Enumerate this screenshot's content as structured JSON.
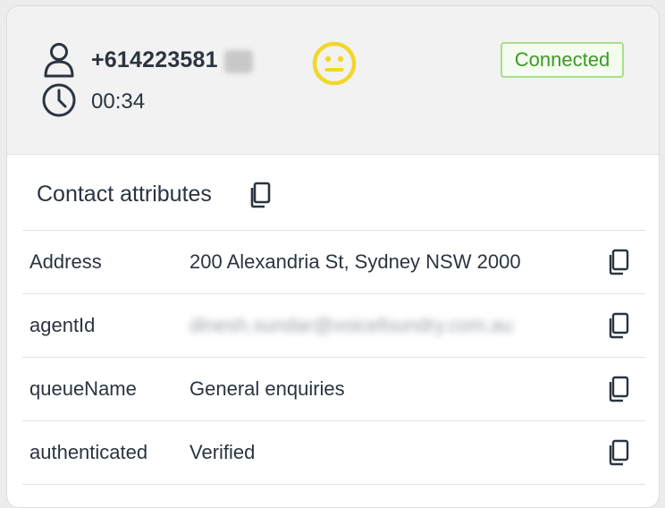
{
  "header": {
    "phone": "+614223581",
    "timer": "00:34",
    "status": "Connected",
    "sentiment_icon": "neutral-face-icon",
    "colors": {
      "status_text": "#3d9a25",
      "status_border": "#a7df8a",
      "face": "#f2d72c"
    }
  },
  "section": {
    "title": "Contact attributes",
    "copy_icon": "copy-icon"
  },
  "attributes": [
    {
      "key": "Address",
      "value": "200 Alexandria St, Sydney NSW 2000"
    },
    {
      "key": "agentId",
      "value": "dinesh.sundar@voicefoundry.com.au"
    },
    {
      "key": "queueName",
      "value": "General enquiries"
    },
    {
      "key": "authenticated",
      "value": "Verified"
    }
  ]
}
